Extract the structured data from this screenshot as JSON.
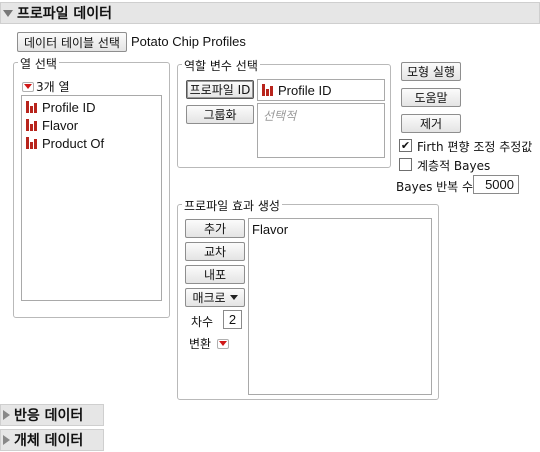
{
  "header": {
    "title": "프로파일 데이터"
  },
  "data_table": {
    "button_label": "데이터 테이블 선택",
    "table_name": "Potato Chip Profiles"
  },
  "columns_panel": {
    "title": "열 선택",
    "count_label": "3개 열",
    "items": [
      {
        "label": "Profile ID",
        "icon": "nominal-bar-icon"
      },
      {
        "label": "Flavor",
        "icon": "nominal-bar-icon"
      },
      {
        "label": "Product Of",
        "icon": "nominal-bar-icon"
      }
    ]
  },
  "roles_panel": {
    "title": "역할 변수 선택",
    "profile_button": "프로파일 ID",
    "profile_value": "Profile ID",
    "grouping_button": "그룹화",
    "grouping_placeholder": "선택적"
  },
  "actions": {
    "run_model": "모형 실행",
    "help": "도움말",
    "remove": "제거"
  },
  "options": {
    "firth_label": "Firth 편향 조정 추정값",
    "firth_checked": true,
    "hierarchical_label": "계층적 Bayes",
    "hierarchical_checked": false,
    "bayes_iter_label": "Bayes 반복 수",
    "bayes_iter_value": "5000"
  },
  "effects_panel": {
    "title": "프로파일 효과 생성",
    "add": "추가",
    "cross": "교차",
    "nest": "내포",
    "macro": "매크로",
    "degree_label": "차수",
    "degree_value": "2",
    "transform_label": "변환",
    "effects": [
      "Flavor"
    ]
  },
  "collapsed_sections": {
    "response_data": "반응 데이터",
    "subject_data": "개체 데이터"
  },
  "colors": {
    "accent_red": "#d01818",
    "nominal_icon": "#b8241c",
    "header_bg": "#e6e6e6"
  }
}
